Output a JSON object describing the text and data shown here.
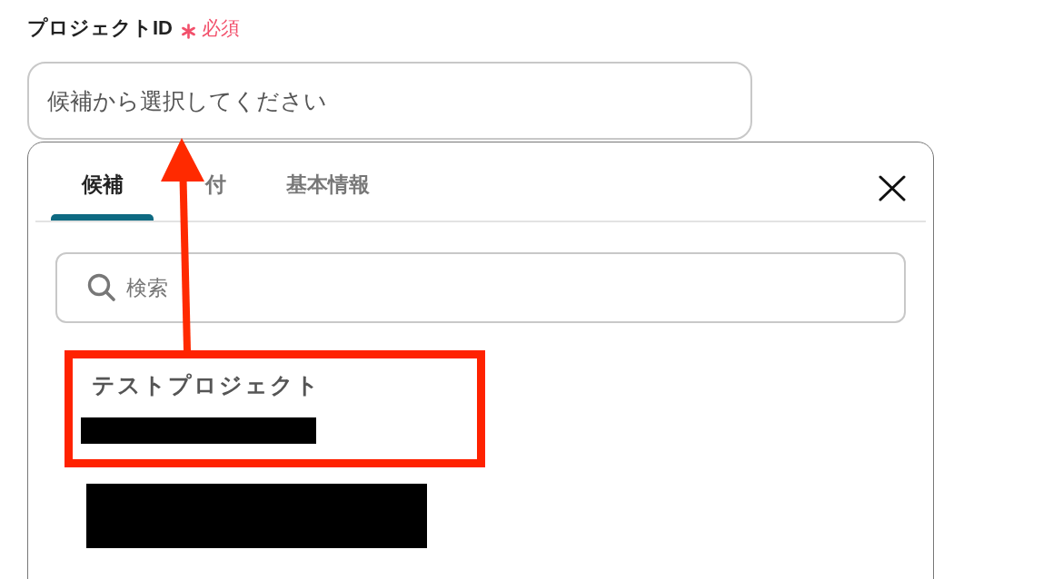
{
  "field": {
    "label": "プロジェクトID",
    "required_label": "必須",
    "placeholder": "候補から選択してください"
  },
  "dropdown": {
    "tabs": [
      {
        "label": "候補",
        "selected": true
      },
      {
        "label": "付",
        "selected": false
      },
      {
        "label": "基本情報",
        "selected": false
      }
    ],
    "search": {
      "placeholder": "検索"
    },
    "items": [
      {
        "kind": "project",
        "title": "テストプロジェクト",
        "annotated": true
      },
      {
        "kind": "redacted",
        "annotated": false
      }
    ]
  }
}
